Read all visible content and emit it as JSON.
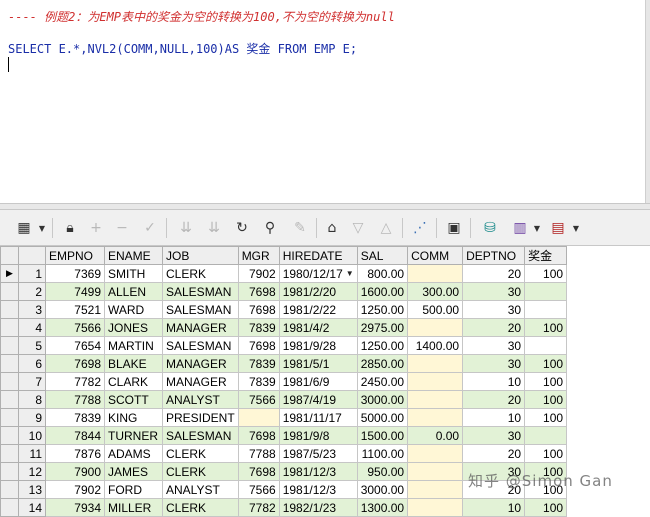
{
  "editor": {
    "comment": "---- 例题2：为EMP表中的奖金为空的转换为100,不为空的转换为null",
    "sql": "SELECT E.*,NVL2(COMM,NULL,100)AS 奖金 FROM EMP E;"
  },
  "toolbar": {
    "icons": [
      "grid-menu-icon",
      "lock-icon",
      "add-record-icon",
      "delete-record-icon",
      "post-edit-icon",
      "query-by-example-icon",
      "clear-filter-icon",
      "refresh-icon",
      "find-icon",
      "clear-icon",
      "home-icon",
      "filter-down-icon",
      "filter-up-icon",
      "chart-icon",
      "save-icon",
      "export-icon",
      "import-icon",
      "print-icon"
    ]
  },
  "grid": {
    "columns": [
      "EMPNO",
      "ENAME",
      "JOB",
      "MGR",
      "HIREDATE",
      "SAL",
      "COMM",
      "DEPTNO",
      "奖金"
    ],
    "rows": [
      {
        "n": "1",
        "empno": "7369",
        "ename": "SMITH",
        "job": "CLERK",
        "mgr": "7902",
        "hiredate": "1980/12/17",
        "sal": "800.00",
        "comm": "",
        "deptno": "20",
        "bonus": "100"
      },
      {
        "n": "2",
        "empno": "7499",
        "ename": "ALLEN",
        "job": "SALESMAN",
        "mgr": "7698",
        "hiredate": "1981/2/20",
        "sal": "1600.00",
        "comm": "300.00",
        "deptno": "30",
        "bonus": ""
      },
      {
        "n": "3",
        "empno": "7521",
        "ename": "WARD",
        "job": "SALESMAN",
        "mgr": "7698",
        "hiredate": "1981/2/22",
        "sal": "1250.00",
        "comm": "500.00",
        "deptno": "30",
        "bonus": ""
      },
      {
        "n": "4",
        "empno": "7566",
        "ename": "JONES",
        "job": "MANAGER",
        "mgr": "7839",
        "hiredate": "1981/4/2",
        "sal": "2975.00",
        "comm": "",
        "deptno": "20",
        "bonus": "100"
      },
      {
        "n": "5",
        "empno": "7654",
        "ename": "MARTIN",
        "job": "SALESMAN",
        "mgr": "7698",
        "hiredate": "1981/9/28",
        "sal": "1250.00",
        "comm": "1400.00",
        "deptno": "30",
        "bonus": ""
      },
      {
        "n": "6",
        "empno": "7698",
        "ename": "BLAKE",
        "job": "MANAGER",
        "mgr": "7839",
        "hiredate": "1981/5/1",
        "sal": "2850.00",
        "comm": "",
        "deptno": "30",
        "bonus": "100"
      },
      {
        "n": "7",
        "empno": "7782",
        "ename": "CLARK",
        "job": "MANAGER",
        "mgr": "7839",
        "hiredate": "1981/6/9",
        "sal": "2450.00",
        "comm": "",
        "deptno": "10",
        "bonus": "100"
      },
      {
        "n": "8",
        "empno": "7788",
        "ename": "SCOTT",
        "job": "ANALYST",
        "mgr": "7566",
        "hiredate": "1987/4/19",
        "sal": "3000.00",
        "comm": "",
        "deptno": "20",
        "bonus": "100"
      },
      {
        "n": "9",
        "empno": "7839",
        "ename": "KING",
        "job": "PRESIDENT",
        "mgr": "",
        "hiredate": "1981/11/17",
        "sal": "5000.00",
        "comm": "",
        "deptno": "10",
        "bonus": "100"
      },
      {
        "n": "10",
        "empno": "7844",
        "ename": "TURNER",
        "job": "SALESMAN",
        "mgr": "7698",
        "hiredate": "1981/9/8",
        "sal": "1500.00",
        "comm": "0.00",
        "deptno": "30",
        "bonus": ""
      },
      {
        "n": "11",
        "empno": "7876",
        "ename": "ADAMS",
        "job": "CLERK",
        "mgr": "7788",
        "hiredate": "1987/5/23",
        "sal": "1100.00",
        "comm": "",
        "deptno": "20",
        "bonus": "100"
      },
      {
        "n": "12",
        "empno": "7900",
        "ename": "JAMES",
        "job": "CLERK",
        "mgr": "7698",
        "hiredate": "1981/12/3",
        "sal": "950.00",
        "comm": "",
        "deptno": "30",
        "bonus": "100"
      },
      {
        "n": "13",
        "empno": "7902",
        "ename": "FORD",
        "job": "ANALYST",
        "mgr": "7566",
        "hiredate": "1981/12/3",
        "sal": "3000.00",
        "comm": "",
        "deptno": "20",
        "bonus": "100"
      },
      {
        "n": "14",
        "empno": "7934",
        "ename": "MILLER",
        "job": "CLERK",
        "mgr": "7782",
        "hiredate": "1982/1/23",
        "sal": "1300.00",
        "comm": "",
        "deptno": "10",
        "bonus": "100"
      }
    ]
  },
  "watermark": "知乎 @Simon Gan"
}
